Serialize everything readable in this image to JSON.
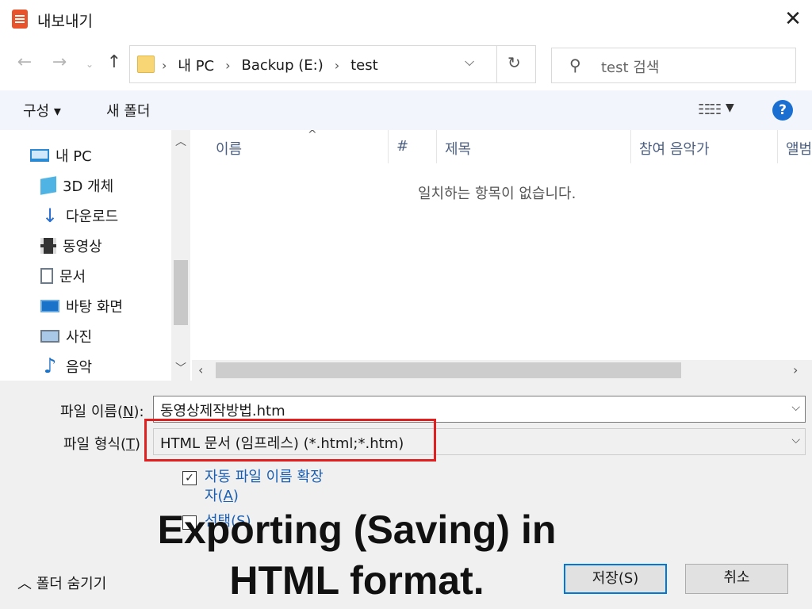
{
  "window": {
    "title": "내보내기"
  },
  "nav": {
    "address": [
      "내 PC",
      "Backup (E:)",
      "test"
    ],
    "search_placeholder": "test 검색"
  },
  "toolbar": {
    "organize": "구성 ▾",
    "new_folder": "새 폴더",
    "help": "?"
  },
  "sidebar": {
    "items": [
      {
        "label": "내 PC",
        "icon": "pc-icon"
      },
      {
        "label": "3D 개체",
        "icon": "3d-objects-icon"
      },
      {
        "label": "다운로드",
        "icon": "download-icon"
      },
      {
        "label": "동영상",
        "icon": "video-icon"
      },
      {
        "label": "문서",
        "icon": "document-icon"
      },
      {
        "label": "바탕 화면",
        "icon": "desktop-icon"
      },
      {
        "label": "사진",
        "icon": "pictures-icon"
      },
      {
        "label": "음악",
        "icon": "music-icon"
      }
    ]
  },
  "list": {
    "columns": [
      "이름",
      "#",
      "제목",
      "참여 음악가",
      "앨범"
    ],
    "empty_message": "일치하는 항목이 없습니다."
  },
  "form": {
    "filename_label": "파일 이름(",
    "filename_key": "N",
    "filename_label_end": "):",
    "filename_value": "동영상제작방법.htm",
    "filetype_label": "파일 형식(",
    "filetype_key": "T",
    "filetype_label_end": ")",
    "filetype_value": "HTML 문서 (임프레스) (*.html;*.htm)",
    "auto_ext_line1": "자동 파일 이름 확장",
    "auto_ext_line2": "자(",
    "auto_ext_key": "A",
    "auto_ext_end": ")",
    "select_label": "선택(S)"
  },
  "footer": {
    "hide_folders": "폴더 숨기기",
    "save": "저장(S)",
    "cancel": "취소"
  },
  "caption": {
    "line1": "Exporting (Saving) in",
    "line2": "HTML format."
  },
  "colors": {
    "accent": "#0078d7",
    "highlight": "#e02020",
    "link": "#1a5fb4"
  }
}
